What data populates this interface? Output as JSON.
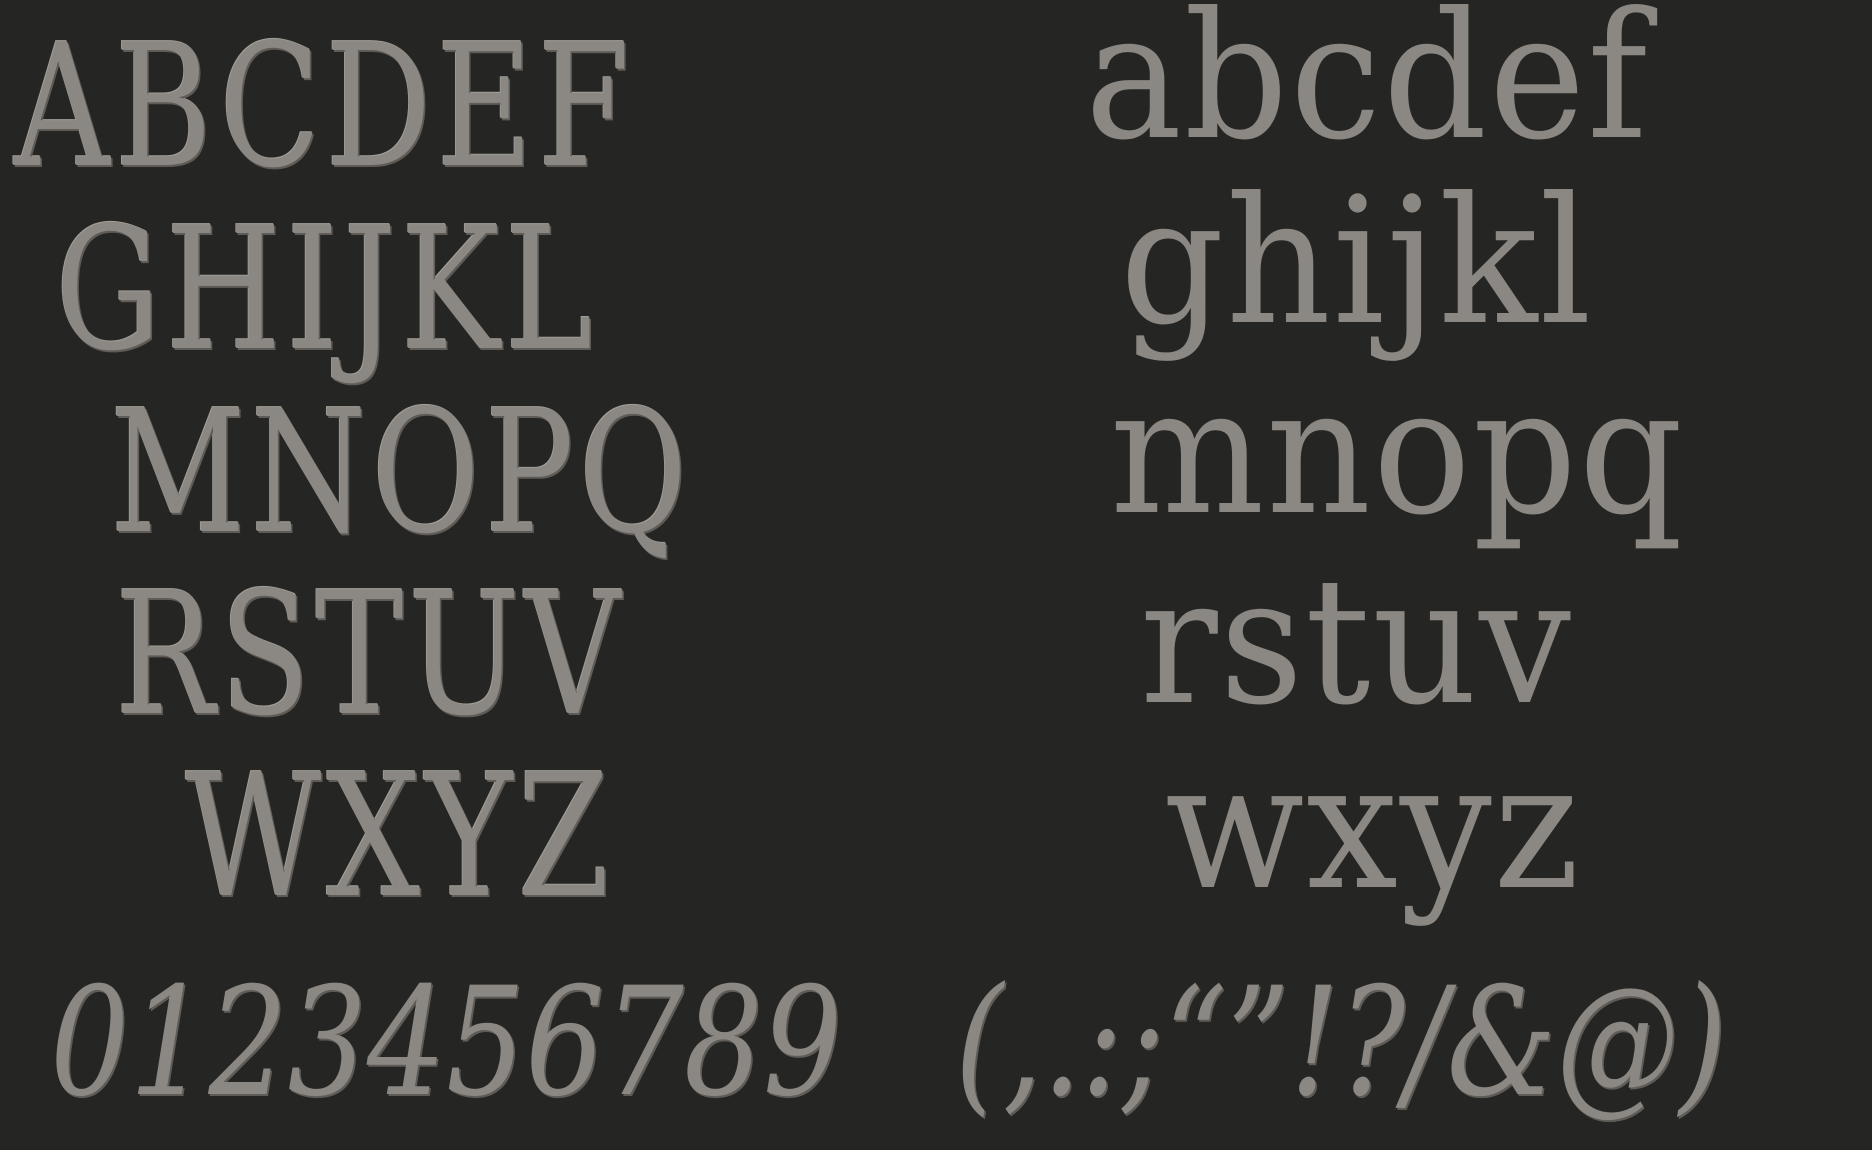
{
  "specimen": {
    "uppercase_rows": [
      "ABCDEF",
      "GHIJKL",
      "MNOPQ",
      "RSTUV",
      "WXYZ"
    ],
    "lowercase_rows": [
      "abcdef",
      "ghijkl",
      "mnopq",
      "rstuv",
      "wxyz"
    ],
    "digits": "0123456789",
    "punctuation": "(,.:;“”!?/&@)"
  },
  "colors": {
    "background": "#252623",
    "glyph": "#8b8782"
  }
}
